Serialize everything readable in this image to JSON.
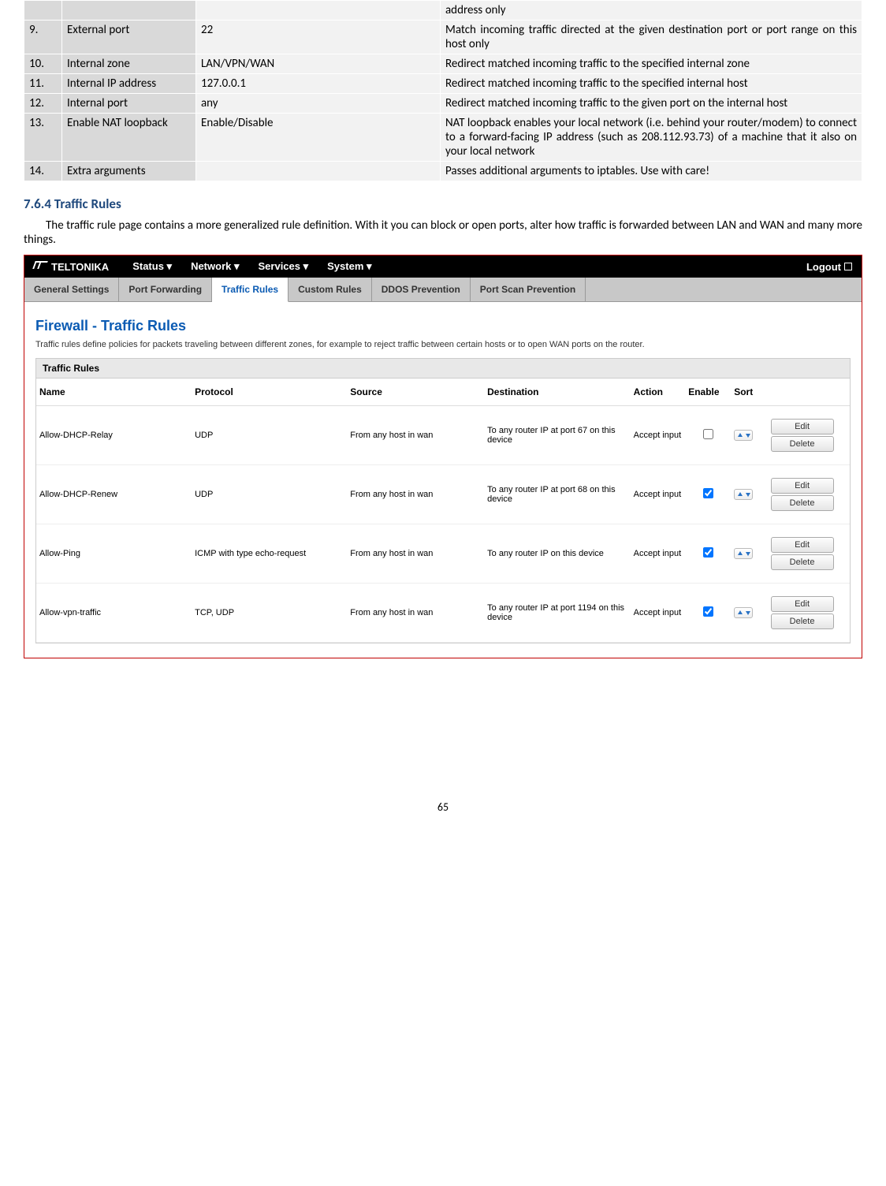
{
  "paramRows": [
    {
      "n": "",
      "name": "",
      "val": "",
      "desc": "address only"
    },
    {
      "n": "9.",
      "name": "External port",
      "val": "22",
      "desc": "Match incoming traffic directed at the given destination port or port range on this host only"
    },
    {
      "n": "10.",
      "name": "Internal zone",
      "val": "LAN/VPN/WAN",
      "desc": "Redirect matched incoming traffic to the specified internal zone"
    },
    {
      "n": "11.",
      "name": "Internal IP address",
      "val": "127.0.0.1",
      "desc": "Redirect matched incoming traffic to the specified internal host"
    },
    {
      "n": "12.",
      "name": "Internal port",
      "val": "any",
      "desc": "Redirect matched incoming traffic to the given port on the internal host"
    },
    {
      "n": "13.",
      "name": "Enable NAT loopback",
      "val": "Enable/Disable",
      "desc": "NAT loopback enables your local network (i.e. behind your router/modem) to connect to a forward-facing IP address (such as 208.112.93.73) of a machine that it also on your local network"
    },
    {
      "n": "14.",
      "name": "Extra arguments",
      "val": "",
      "desc": "Passes additional arguments to iptables. Use with care!"
    }
  ],
  "section": {
    "num": "7.6.4",
    "title": "Traffic Rules"
  },
  "para": "The traffic rule page contains a more generalized rule definition. With it you can block or open ports, alter how traffic is forwarded between LAN and WAN and many more things.",
  "shot": {
    "brand": "TELTONIKA",
    "nav": [
      "Status",
      "Network",
      "Services",
      "System"
    ],
    "logout": "Logout",
    "tabs": [
      "General Settings",
      "Port Forwarding",
      "Traffic Rules",
      "Custom Rules",
      "DDOS Prevention",
      "Port Scan Prevention"
    ],
    "activeTab": 2,
    "h1": "Firewall - Traffic Rules",
    "desc": "Traffic rules define policies for packets traveling between different zones, for example to reject traffic between certain hosts or to open WAN ports on the router.",
    "panelTitle": "Traffic Rules",
    "cols": {
      "name": "Name",
      "proto": "Protocol",
      "src": "Source",
      "dest": "Destination",
      "action": "Action",
      "enable": "Enable",
      "sort": "Sort"
    },
    "btnEdit": "Edit",
    "btnDelete": "Delete",
    "rules": [
      {
        "name": "Allow-DHCP-Relay",
        "proto": "UDP",
        "src": "From any host in wan",
        "dest": "To any router IP at port 67 on this device",
        "action": "Accept input",
        "enable": false
      },
      {
        "name": "Allow-DHCP-Renew",
        "proto": "UDP",
        "src": "From any host in wan",
        "dest": "To any router IP at port 68 on this device",
        "action": "Accept input",
        "enable": true
      },
      {
        "name": "Allow-Ping",
        "proto": "ICMP with type echo-request",
        "src": "From any host in wan",
        "dest": "To any router IP on this device",
        "action": "Accept input",
        "enable": true
      },
      {
        "name": "Allow-vpn-traffic",
        "proto": "TCP, UDP",
        "src": "From any host in wan",
        "dest": "To any router IP at port 1194 on this device",
        "action": "Accept input",
        "enable": true
      }
    ]
  },
  "pageNumber": "65"
}
